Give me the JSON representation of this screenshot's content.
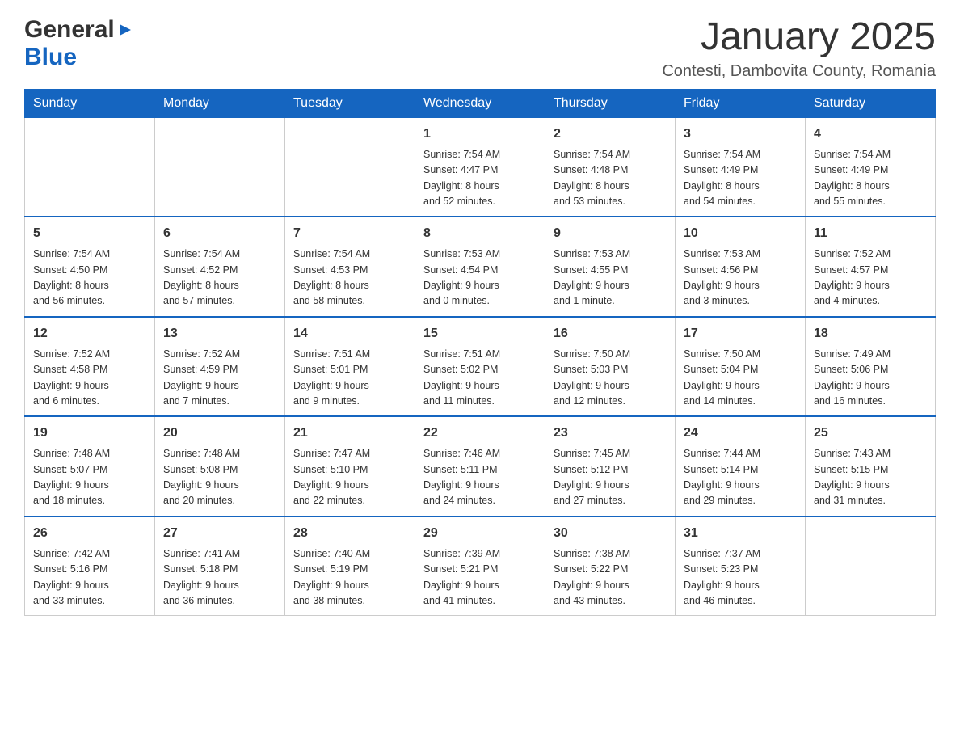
{
  "header": {
    "logo_general": "General",
    "logo_blue": "Blue",
    "month_title": "January 2025",
    "location": "Contesti, Dambovita County, Romania"
  },
  "days_of_week": [
    "Sunday",
    "Monday",
    "Tuesday",
    "Wednesday",
    "Thursday",
    "Friday",
    "Saturday"
  ],
  "weeks": [
    [
      {
        "day": "",
        "info": ""
      },
      {
        "day": "",
        "info": ""
      },
      {
        "day": "",
        "info": ""
      },
      {
        "day": "1",
        "info": "Sunrise: 7:54 AM\nSunset: 4:47 PM\nDaylight: 8 hours\nand 52 minutes."
      },
      {
        "day": "2",
        "info": "Sunrise: 7:54 AM\nSunset: 4:48 PM\nDaylight: 8 hours\nand 53 minutes."
      },
      {
        "day": "3",
        "info": "Sunrise: 7:54 AM\nSunset: 4:49 PM\nDaylight: 8 hours\nand 54 minutes."
      },
      {
        "day": "4",
        "info": "Sunrise: 7:54 AM\nSunset: 4:49 PM\nDaylight: 8 hours\nand 55 minutes."
      }
    ],
    [
      {
        "day": "5",
        "info": "Sunrise: 7:54 AM\nSunset: 4:50 PM\nDaylight: 8 hours\nand 56 minutes."
      },
      {
        "day": "6",
        "info": "Sunrise: 7:54 AM\nSunset: 4:52 PM\nDaylight: 8 hours\nand 57 minutes."
      },
      {
        "day": "7",
        "info": "Sunrise: 7:54 AM\nSunset: 4:53 PM\nDaylight: 8 hours\nand 58 minutes."
      },
      {
        "day": "8",
        "info": "Sunrise: 7:53 AM\nSunset: 4:54 PM\nDaylight: 9 hours\nand 0 minutes."
      },
      {
        "day": "9",
        "info": "Sunrise: 7:53 AM\nSunset: 4:55 PM\nDaylight: 9 hours\nand 1 minute."
      },
      {
        "day": "10",
        "info": "Sunrise: 7:53 AM\nSunset: 4:56 PM\nDaylight: 9 hours\nand 3 minutes."
      },
      {
        "day": "11",
        "info": "Sunrise: 7:52 AM\nSunset: 4:57 PM\nDaylight: 9 hours\nand 4 minutes."
      }
    ],
    [
      {
        "day": "12",
        "info": "Sunrise: 7:52 AM\nSunset: 4:58 PM\nDaylight: 9 hours\nand 6 minutes."
      },
      {
        "day": "13",
        "info": "Sunrise: 7:52 AM\nSunset: 4:59 PM\nDaylight: 9 hours\nand 7 minutes."
      },
      {
        "day": "14",
        "info": "Sunrise: 7:51 AM\nSunset: 5:01 PM\nDaylight: 9 hours\nand 9 minutes."
      },
      {
        "day": "15",
        "info": "Sunrise: 7:51 AM\nSunset: 5:02 PM\nDaylight: 9 hours\nand 11 minutes."
      },
      {
        "day": "16",
        "info": "Sunrise: 7:50 AM\nSunset: 5:03 PM\nDaylight: 9 hours\nand 12 minutes."
      },
      {
        "day": "17",
        "info": "Sunrise: 7:50 AM\nSunset: 5:04 PM\nDaylight: 9 hours\nand 14 minutes."
      },
      {
        "day": "18",
        "info": "Sunrise: 7:49 AM\nSunset: 5:06 PM\nDaylight: 9 hours\nand 16 minutes."
      }
    ],
    [
      {
        "day": "19",
        "info": "Sunrise: 7:48 AM\nSunset: 5:07 PM\nDaylight: 9 hours\nand 18 minutes."
      },
      {
        "day": "20",
        "info": "Sunrise: 7:48 AM\nSunset: 5:08 PM\nDaylight: 9 hours\nand 20 minutes."
      },
      {
        "day": "21",
        "info": "Sunrise: 7:47 AM\nSunset: 5:10 PM\nDaylight: 9 hours\nand 22 minutes."
      },
      {
        "day": "22",
        "info": "Sunrise: 7:46 AM\nSunset: 5:11 PM\nDaylight: 9 hours\nand 24 minutes."
      },
      {
        "day": "23",
        "info": "Sunrise: 7:45 AM\nSunset: 5:12 PM\nDaylight: 9 hours\nand 27 minutes."
      },
      {
        "day": "24",
        "info": "Sunrise: 7:44 AM\nSunset: 5:14 PM\nDaylight: 9 hours\nand 29 minutes."
      },
      {
        "day": "25",
        "info": "Sunrise: 7:43 AM\nSunset: 5:15 PM\nDaylight: 9 hours\nand 31 minutes."
      }
    ],
    [
      {
        "day": "26",
        "info": "Sunrise: 7:42 AM\nSunset: 5:16 PM\nDaylight: 9 hours\nand 33 minutes."
      },
      {
        "day": "27",
        "info": "Sunrise: 7:41 AM\nSunset: 5:18 PM\nDaylight: 9 hours\nand 36 minutes."
      },
      {
        "day": "28",
        "info": "Sunrise: 7:40 AM\nSunset: 5:19 PM\nDaylight: 9 hours\nand 38 minutes."
      },
      {
        "day": "29",
        "info": "Sunrise: 7:39 AM\nSunset: 5:21 PM\nDaylight: 9 hours\nand 41 minutes."
      },
      {
        "day": "30",
        "info": "Sunrise: 7:38 AM\nSunset: 5:22 PM\nDaylight: 9 hours\nand 43 minutes."
      },
      {
        "day": "31",
        "info": "Sunrise: 7:37 AM\nSunset: 5:23 PM\nDaylight: 9 hours\nand 46 minutes."
      },
      {
        "day": "",
        "info": ""
      }
    ]
  ]
}
